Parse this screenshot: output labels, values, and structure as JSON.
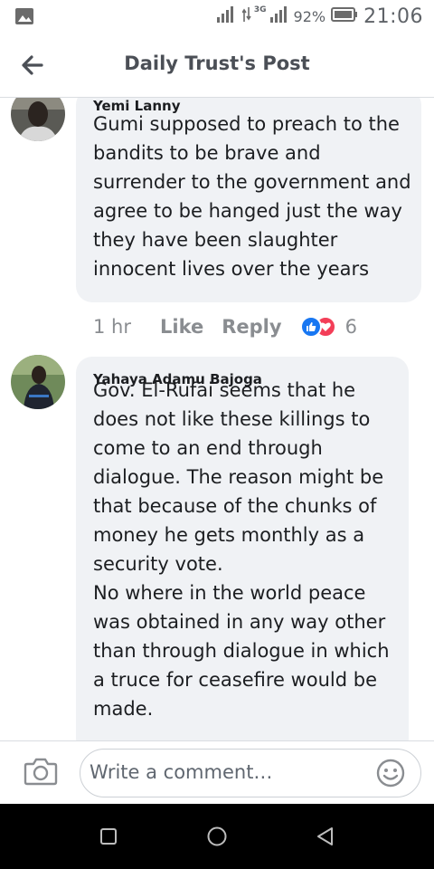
{
  "status_bar": {
    "network": "3G",
    "battery": "92%",
    "time": "21:06"
  },
  "header": {
    "title": "Daily Trust's Post"
  },
  "comments": [
    {
      "author": "Yemi Lanny",
      "text": "Gumi supposed to preach to the bandits to be brave and surrender to the government and agree to be hanged just the way they have been slaughter innocent lives over the years",
      "time": "1 hr",
      "like_label": "Like",
      "reply_label": "Reply",
      "reaction_count": "6",
      "reactions": [
        "like",
        "love"
      ]
    },
    {
      "author": "Yahaya Adamu Bajoga",
      "text": "Gov. El-Rufai seems that he does not like these killings to come to an end through dialogue. The reason might be that because of the chunks of money he gets monthly as a security vote.\nNo where in the world peace was obtained in any way other than through dialogue in which a truce for ceasefire would be made."
    }
  ],
  "composer": {
    "placeholder": "Write a comment…"
  },
  "colors": {
    "like_blue": "#1877f2",
    "love_red": "#f33e58",
    "bubble_bg": "#f0f2f5",
    "meta_gray": "#8a8d91"
  },
  "icons": [
    "image-icon",
    "signal-icon",
    "battery-icon",
    "back-arrow-icon",
    "like-reaction-icon",
    "love-reaction-icon",
    "camera-icon",
    "emoji-icon",
    "recents-icon",
    "home-icon",
    "back-nav-icon"
  ]
}
